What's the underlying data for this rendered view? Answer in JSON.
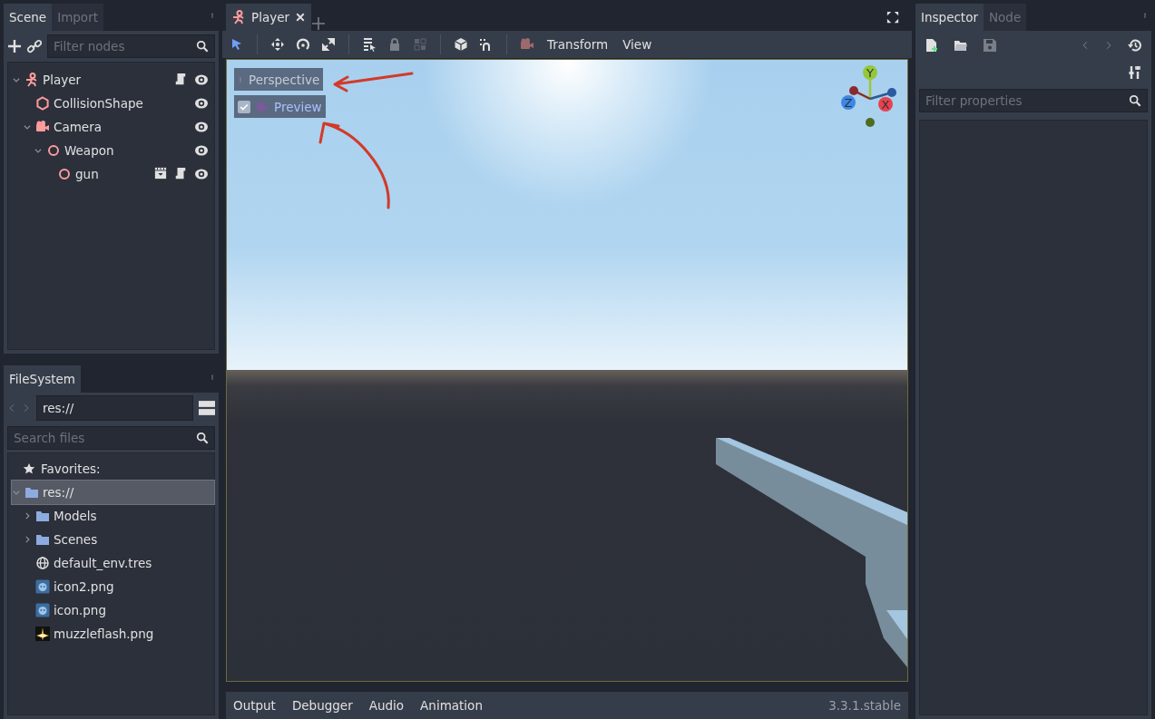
{
  "scene_dock": {
    "tabs": [
      {
        "label": "Scene",
        "selected": true
      },
      {
        "label": "Import",
        "selected": false
      }
    ],
    "filter": {
      "placeholder": "Filter nodes"
    },
    "tree": [
      {
        "name": "Player",
        "kind": "kinematic",
        "expanded": true,
        "script": true,
        "instanced": false,
        "visible": true,
        "children": [
          {
            "name": "CollisionShape",
            "kind": "collision",
            "script": false,
            "instanced": false,
            "visible": true
          },
          {
            "name": "Camera",
            "kind": "camera",
            "expanded": true,
            "script": false,
            "instanced": false,
            "visible": true,
            "children": [
              {
                "name": "Weapon",
                "kind": "spatial",
                "expanded": true,
                "script": false,
                "instanced": false,
                "visible": true,
                "children": [
                  {
                    "name": "gun",
                    "kind": "spatial",
                    "script": true,
                    "instanced": true,
                    "visible": true
                  }
                ]
              }
            ]
          }
        ]
      }
    ]
  },
  "filesystem": {
    "tabs": [
      {
        "label": "FileSystem",
        "selected": true
      }
    ],
    "path": "res://",
    "search": {
      "placeholder": "Search files"
    },
    "favorites": "Favorites:",
    "tree": [
      {
        "name": "res://",
        "kind": "folder",
        "selected": true,
        "expanded": true,
        "children": [
          {
            "name": "Models",
            "kind": "folder",
            "selected": false,
            "expanded": false
          },
          {
            "name": "Scenes",
            "kind": "folder",
            "selected": false,
            "expanded": false
          },
          {
            "name": "default_env.tres",
            "kind": "env",
            "selected": false
          },
          {
            "name": "icon2.png",
            "kind": "image",
            "selected": false
          },
          {
            "name": "icon.png",
            "kind": "image",
            "selected": false
          },
          {
            "name": "muzzleflash.png",
            "kind": "flash",
            "selected": false
          }
        ]
      }
    ]
  },
  "editor": {
    "tabs": [
      {
        "label": "Player",
        "selected": true
      }
    ],
    "toolbar": {
      "tools": [
        {
          "kind": "select",
          "selected": true,
          "disabled": false
        },
        {
          "kind": "move",
          "selected": false,
          "disabled": false
        },
        {
          "kind": "rotate",
          "selected": false,
          "disabled": false
        },
        {
          "kind": "scale",
          "selected": false,
          "disabled": false
        },
        {
          "kind": "list",
          "selected": false,
          "disabled": false
        },
        {
          "kind": "lock",
          "selected": false,
          "disabled": true
        },
        {
          "kind": "group",
          "selected": false,
          "disabled": true
        },
        {
          "kind": "local",
          "selected": false,
          "disabled": false
        },
        {
          "kind": "snap",
          "selected": false,
          "disabled": false
        },
        {
          "kind": "camera",
          "selected": false,
          "disabled": true
        }
      ],
      "menus": [
        "Transform",
        "View"
      ]
    },
    "viewport": {
      "view_menu": "Perspective",
      "preview": {
        "label": "Preview",
        "checked": true
      },
      "gizmo": {
        "y": "Y",
        "z": "Z",
        "x": "X"
      }
    }
  },
  "bottom_panel": {
    "tabs": [
      "Output",
      "Debugger",
      "Audio",
      "Animation"
    ],
    "version": "3.3.1.stable"
  },
  "inspector": {
    "tabs": [
      {
        "label": "Inspector",
        "selected": true
      },
      {
        "label": "Node",
        "selected": false
      }
    ],
    "filter": {
      "placeholder": "Filter properties"
    }
  }
}
